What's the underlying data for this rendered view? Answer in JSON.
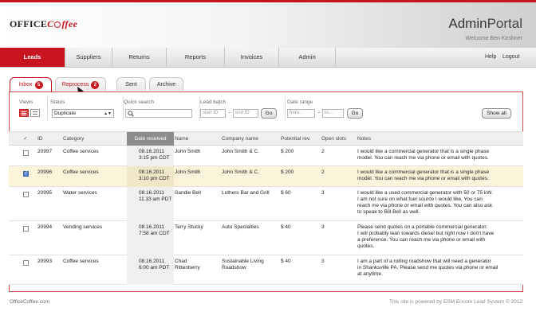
{
  "brand": {
    "logo_text": "OFFICECoffee",
    "portal_left": "Admin",
    "portal_right": "Portal",
    "welcome": "Welcome Ben Kirshner"
  },
  "nav": {
    "tabs": [
      "Leads",
      "Suppliers",
      "Returns",
      "Reports",
      "Invoices",
      "Admin"
    ],
    "active": "Leads",
    "help": "Help",
    "logout": "Logout"
  },
  "subtabs": {
    "inbox": {
      "label": "Inbox",
      "count": "5"
    },
    "reprocess": {
      "label": "Reprocess",
      "count": "2"
    },
    "sent": "Sent",
    "archive": "Archive"
  },
  "filters": {
    "views_label": "Views",
    "status_label": "Status",
    "status_value": "Duplicate",
    "quick_search_label": "Quick search",
    "lead_batch_label": "Lead batch",
    "start_id_placeholder": "start ID",
    "dash1": "–",
    "end_id_placeholder": "end ID",
    "go1": "Go",
    "date_range_label": "Date range",
    "from_placeholder": "from...",
    "dash2": "–",
    "to_placeholder": "to...",
    "go2": "Go",
    "show_all": "Show all"
  },
  "table": {
    "headers": {
      "check": "✓",
      "id": "ID",
      "category": "Category",
      "date": "Date received",
      "name": "Name",
      "company": "Company name",
      "potential": "Potential rev.",
      "slots": "Open slots",
      "notes": "Notes"
    },
    "rows": [
      {
        "checked": false,
        "id": "20997",
        "category": "Coffee services",
        "date1": "08.16.2011",
        "date2": "3:15 pm CDT",
        "name1": "John Smith",
        "name2": "",
        "company1": "John Smith & C.",
        "company2": "",
        "rev": "$ 200",
        "slots": "2",
        "notes": [
          "I would like a commercial generator that is a single phase",
          "model. You can reach me via phone or email with quotes."
        ]
      },
      {
        "checked": true,
        "id": "20996",
        "category": "Coffee services",
        "date1": "08.16.2011",
        "date2": "3:10 pm CDT",
        "name1": "John Smith",
        "name2": "",
        "company1": "John Smith & C.",
        "company2": "",
        "rev": "$ 200",
        "slots": "2",
        "notes": [
          "I would like a commercial generator that is a single phase",
          "model. You can reach me via phone or email with quotes."
        ]
      },
      {
        "checked": false,
        "id": "20995",
        "category": "Water services",
        "date1": "08.16.2011",
        "date2": "11.33 am PDT",
        "name1": "Sandie Bell",
        "name2": "",
        "company1": "Luthers Bar and Grill",
        "company2": "",
        "rev": "$  60",
        "slots": "3",
        "notes": [
          "I would like a used commercial generator with 50 or 75 kW.",
          "I am not sure on what fuel source I would like. You can",
          "reach me via phone or email with quotes. You can also ask",
          "to speak to Bill Bell as well."
        ]
      },
      {
        "checked": false,
        "id": "20994",
        "category": "Vending services",
        "date1": "08.16.2011",
        "date2": "7:58 am CDT",
        "name1": "Terry Stucky",
        "name2": "",
        "company1": "Auto Specialties",
        "company2": "",
        "rev": "$  40",
        "slots": "3",
        "notes": [
          "Please send quotes on a portable commercial generator.",
          "I will probably lean towards diesel but right now I don't have",
          "a preference. You can reach me via phone or email with",
          "quotes."
        ]
      },
      {
        "checked": false,
        "id": "20993",
        "category": "Coffee services",
        "date1": "08.16.2011",
        "date2": "6:00 am PDT",
        "name1": "Chad",
        "name2": "Rittenberry",
        "company1": "Sustainable Living",
        "company2": "Roadshow",
        "rev": "$  40",
        "slots": "3",
        "notes": [
          "I am a part of a rolling roadshow that will need a generator",
          "in Shanksville PA. Please send me quotes via phone or email",
          "at anytime."
        ]
      }
    ]
  },
  "footer": {
    "left": "OfficeCoffee.com",
    "right": "This site is powered by ESM Encore Lead System © 2012"
  },
  "colors": {
    "brand_red": "#c8141e",
    "selected_row": "#fcf4da"
  }
}
